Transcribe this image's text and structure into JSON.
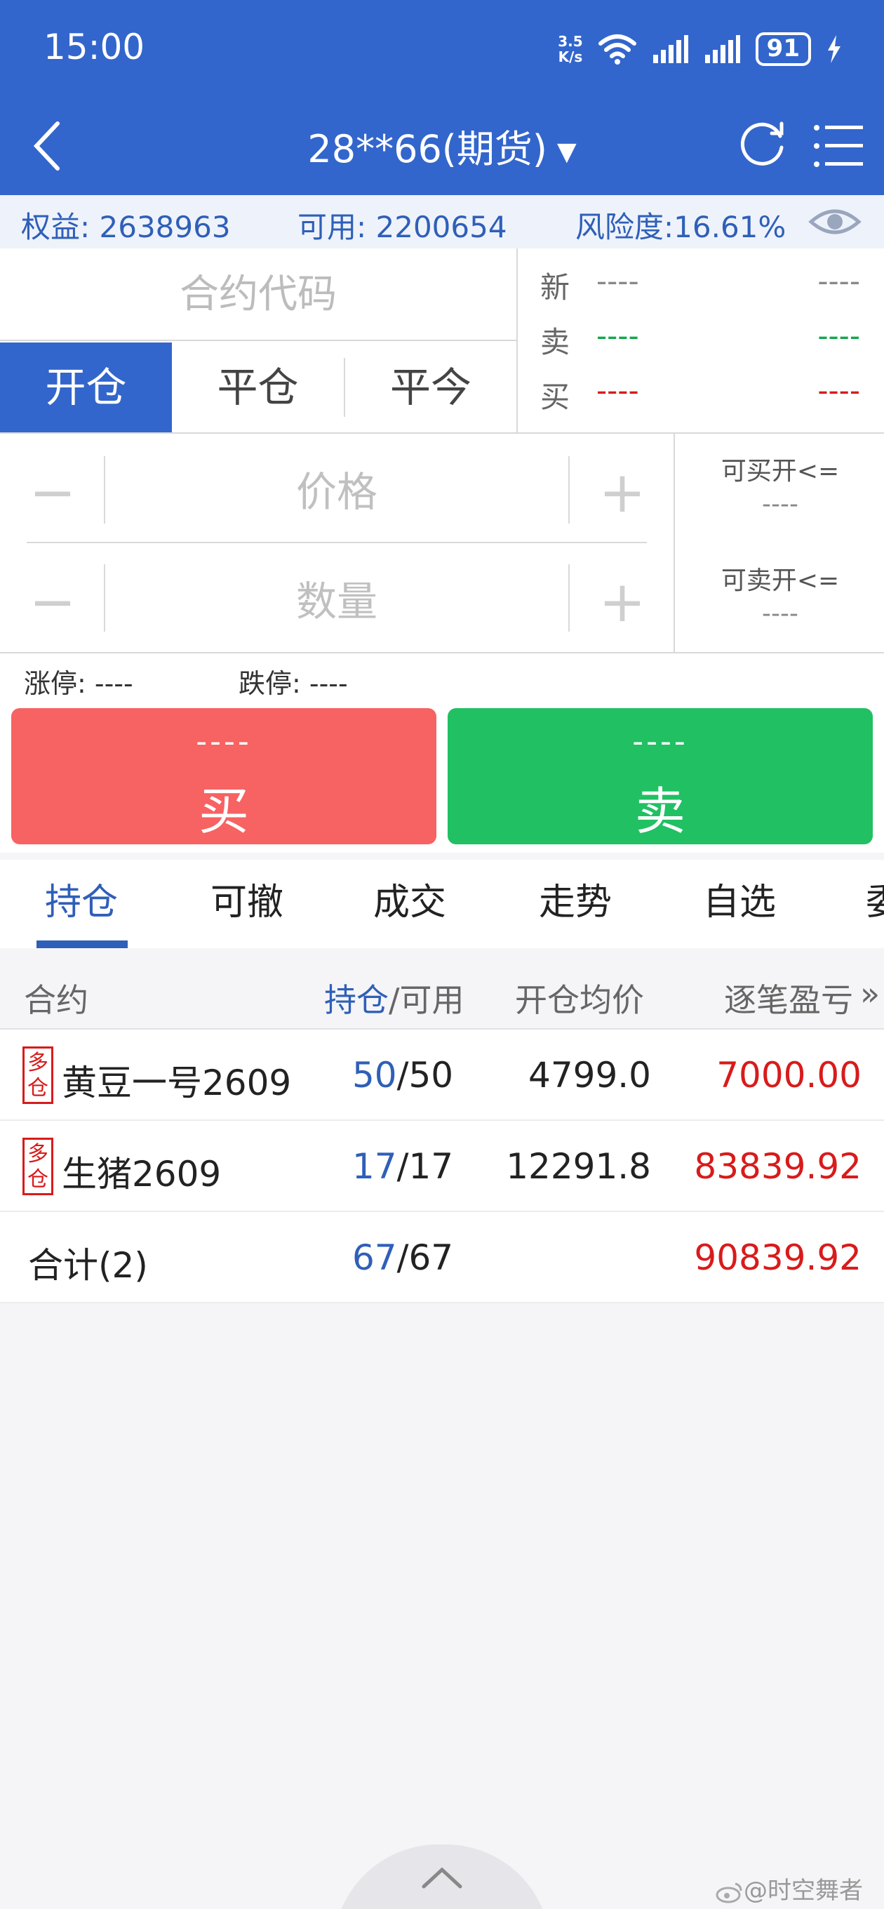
{
  "status_bar": {
    "time": "15:00",
    "netspeed_value": "3.5",
    "netspeed_unit": "K/s",
    "battery": "91"
  },
  "header": {
    "title": "28**66(期货)",
    "caret": "▼",
    "colors": {
      "primary": "#3366cc"
    }
  },
  "account": {
    "equity": "权益: 2638963",
    "available": "可用: 2200654",
    "risk": "风险度:16.61%"
  },
  "order_form": {
    "contract_placeholder": "合约代码",
    "mode_tabs": [
      "开仓",
      "平仓",
      "平今"
    ],
    "active_mode_index": 0,
    "price_placeholder": "价格",
    "quantity_placeholder": "数量",
    "minus_label": "−",
    "plus_label": "+",
    "can_buy_open_label": "可买开<=",
    "can_buy_open_value": "----",
    "can_sell_open_label": "可卖开<=",
    "can_sell_open_value": "----"
  },
  "quote": {
    "rows": [
      {
        "label": "新",
        "v1": "----",
        "v2": "----",
        "color": "#888888"
      },
      {
        "label": "卖",
        "v1": "----",
        "v2": "----",
        "color": "#11a84a"
      },
      {
        "label": "买",
        "v1": "----",
        "v2": "----",
        "color": "#d81b1b"
      }
    ]
  },
  "limits": {
    "limit_up": "涨停: ----",
    "limit_down": "跌停: ----"
  },
  "trade_buttons": {
    "buy": {
      "price": "----",
      "label": "买",
      "color": "#f76262"
    },
    "sell": {
      "price": "----",
      "label": "卖",
      "color": "#21c063"
    }
  },
  "bottom_tabs": {
    "items": [
      "持仓",
      "可撤",
      "成交",
      "走势",
      "自选",
      "委"
    ],
    "active_index": 0
  },
  "positions": {
    "headers": {
      "contract": "合约",
      "hold": "持仓",
      "avail": "/可用",
      "avg_price": "开仓均价",
      "pnl": "逐笔盈亏",
      "more": "»"
    },
    "rows": [
      {
        "badge_top": "多",
        "badge_bottom": "仓",
        "name": "黄豆一号2609",
        "hold": "50",
        "avail": "/50",
        "avg_price": "4799.0",
        "pnl": "7000.00"
      },
      {
        "badge_top": "多",
        "badge_bottom": "仓",
        "name": "生猪2609",
        "hold": "17",
        "avail": "/17",
        "avg_price": "12291.8",
        "pnl": "83839.92"
      }
    ],
    "total": {
      "label": "合计(2)",
      "hold": "67",
      "avail": "/67",
      "pnl": "90839.92"
    }
  },
  "watermark": "@时空舞者"
}
